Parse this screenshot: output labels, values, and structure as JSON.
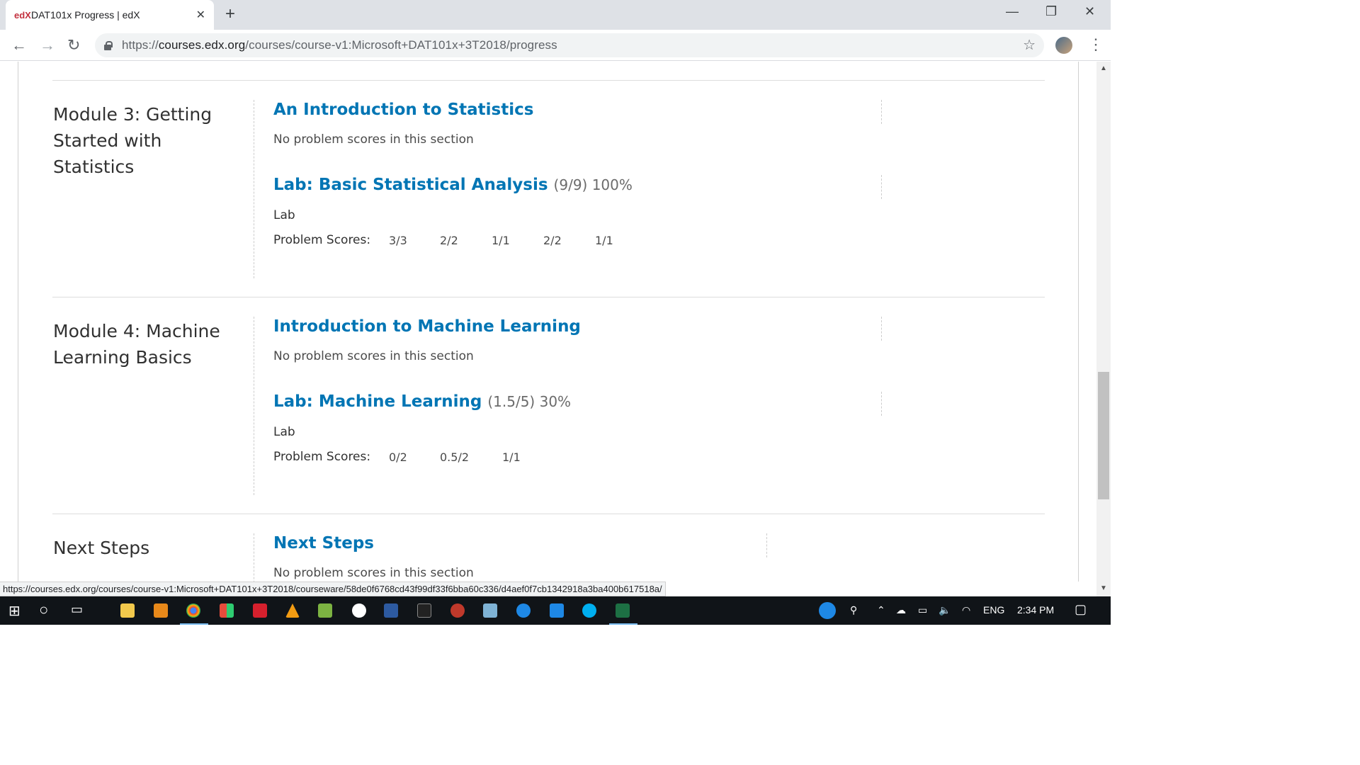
{
  "browser": {
    "tab_title": "DAT101x Progress | edX",
    "favicon": "edX",
    "url_prefix": "https://",
    "url_domain": "courses.edx.org",
    "url_path": "/courses/course-v1:Microsoft+DAT101x+3T2018/progress"
  },
  "modules": [
    {
      "title": "Module 3: Getting Started with Statistics",
      "sections": [
        {
          "title": "An Introduction to Statistics",
          "score": "",
          "note": "No problem scores in this section"
        },
        {
          "title": "Lab: Basic Statistical Analysis",
          "score": "(9/9) 100%",
          "type": "Lab",
          "scores_label": "Problem Scores:",
          "scores": [
            "3/3",
            "2/2",
            "1/1",
            "2/2",
            "1/1"
          ]
        }
      ]
    },
    {
      "title": "Module 4: Machine Learning Basics",
      "sections": [
        {
          "title": "Introduction to Machine Learning",
          "score": "",
          "note": "No problem scores in this section"
        },
        {
          "title": "Lab: Machine Learning",
          "score": "(1.5/5) 30%",
          "type": "Lab",
          "scores_label": "Problem Scores:",
          "scores": [
            "0/2",
            "0.5/2",
            "1/1"
          ]
        }
      ]
    },
    {
      "title": "Next Steps",
      "sections": [
        {
          "title": "Next Steps",
          "score": "",
          "note": "No problem scores in this section"
        }
      ]
    }
  ],
  "status_url": "https://courses.edx.org/courses/course-v1:Microsoft+DAT101x+3T2018/courseware/58de0f6768cd43f99df33f6bba60c336/d4aef0f7cb1342918a3ba400b617518a/",
  "taskbar": {
    "lang": "ENG",
    "time": "2:34 PM"
  },
  "colors": {
    "link": "#0075b4",
    "muted": "#6b6b6b",
    "taskbar": "#101418"
  }
}
